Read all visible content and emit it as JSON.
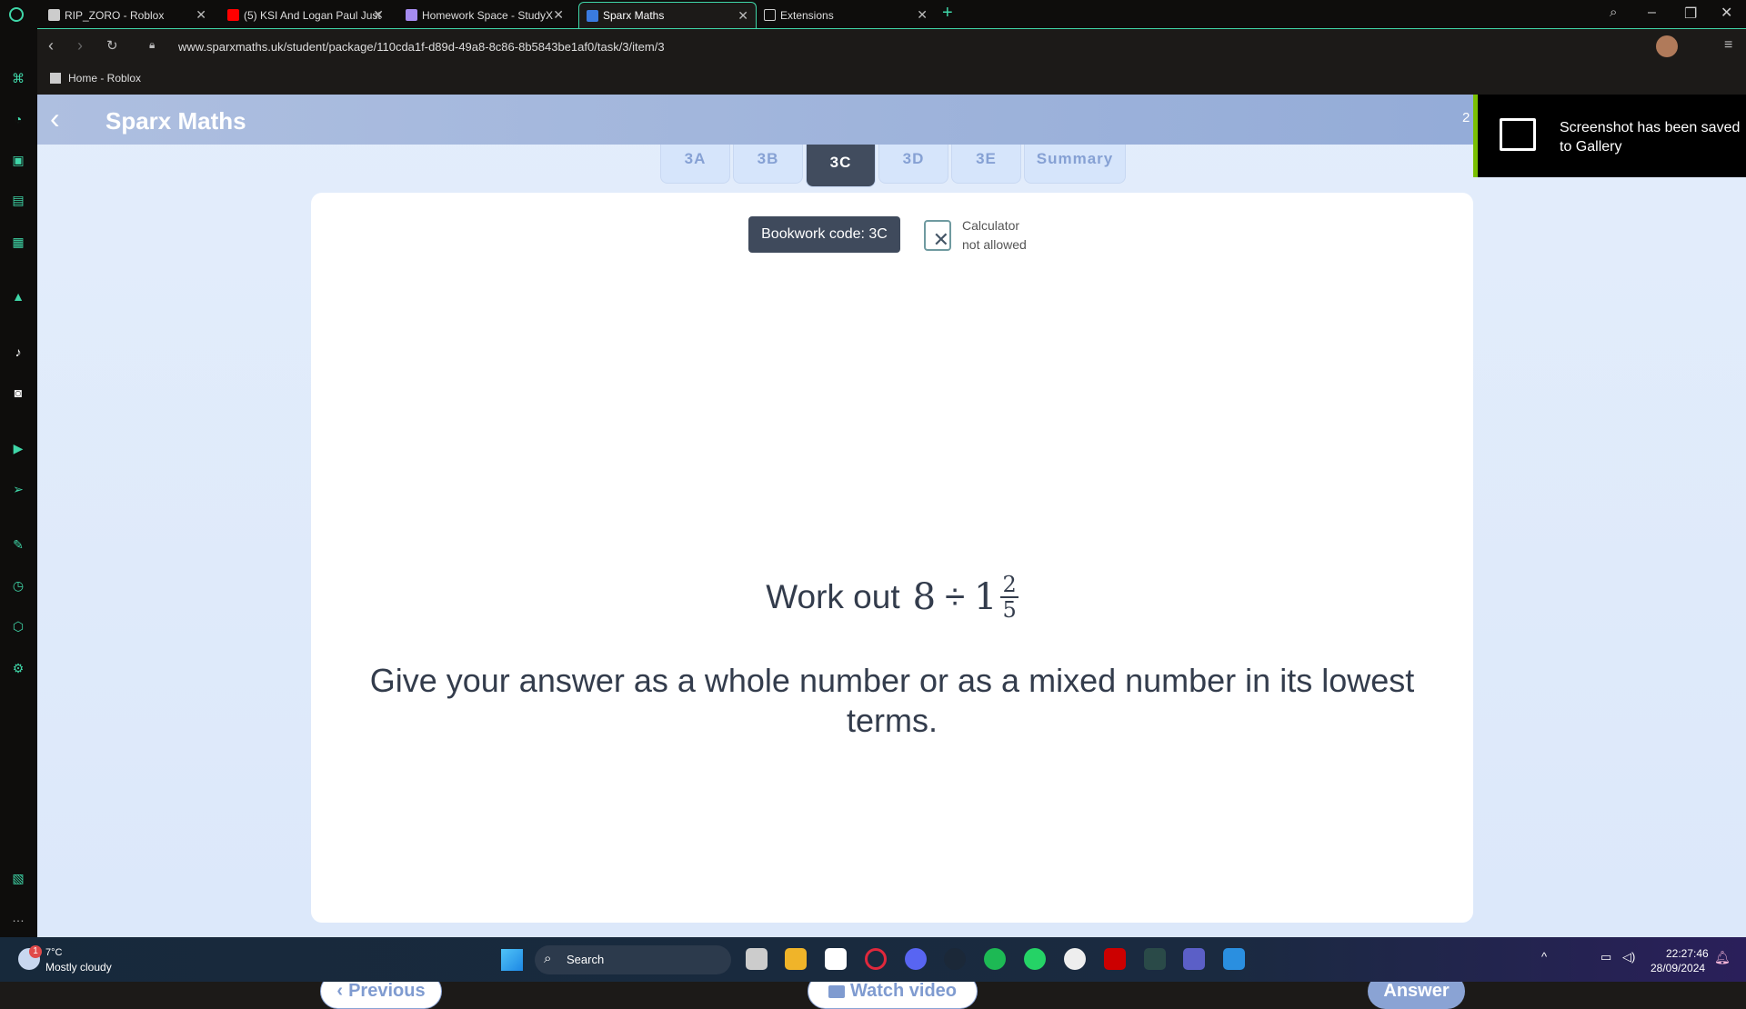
{
  "browser": {
    "tabs": [
      {
        "label": "RIP_ZORO - Roblox",
        "active": false
      },
      {
        "label": "(5) KSI And Logan Paul Just",
        "active": false
      },
      {
        "label": "Homework Space - StudyX",
        "active": false
      },
      {
        "label": "Sparx Maths",
        "active": true
      },
      {
        "label": "Extensions",
        "active": false
      }
    ],
    "new_tab": "+",
    "url": "www.sparxmaths.uk/student/package/110cda1f-d89d-49a8-8c86-8b5843be1af0/task/3/item/3",
    "bookmark": "Home - Roblox"
  },
  "app": {
    "title": "Sparx Maths",
    "header_badge": "2",
    "task_tabs": [
      {
        "label": "3A",
        "active": false
      },
      {
        "label": "3B",
        "active": false
      },
      {
        "label": "3C",
        "active": true
      },
      {
        "label": "3D",
        "active": false
      },
      {
        "label": "3E",
        "active": false
      },
      {
        "label": "Summary",
        "active": false
      }
    ],
    "bookwork_code": "Bookwork code: 3C",
    "calculator_line1": "Calculator",
    "calculator_line2": "not allowed",
    "question": {
      "prefix": "Work out",
      "dividend": "8",
      "operator": "÷",
      "whole": "1",
      "numerator": "2",
      "denominator": "5"
    },
    "instruction": "Give your answer as a whole number or as a mixed number in its lowest terms.",
    "buttons": {
      "previous": "Previous",
      "watch_video": "Watch video",
      "answer": "Answer"
    }
  },
  "toast": {
    "message": "Screenshot has been saved to Gallery",
    "accent": "#7ac000"
  },
  "taskbar": {
    "weather_temp": "7°C",
    "weather_desc": "Mostly cloudy",
    "weather_badge": "1",
    "search": "Search",
    "time": "22:27:46",
    "date": "28/09/2024"
  },
  "colors": {
    "accent": "#3fd6a8",
    "sparx_blue": "#8aa3d4",
    "dark_tab": "#414c5e"
  }
}
